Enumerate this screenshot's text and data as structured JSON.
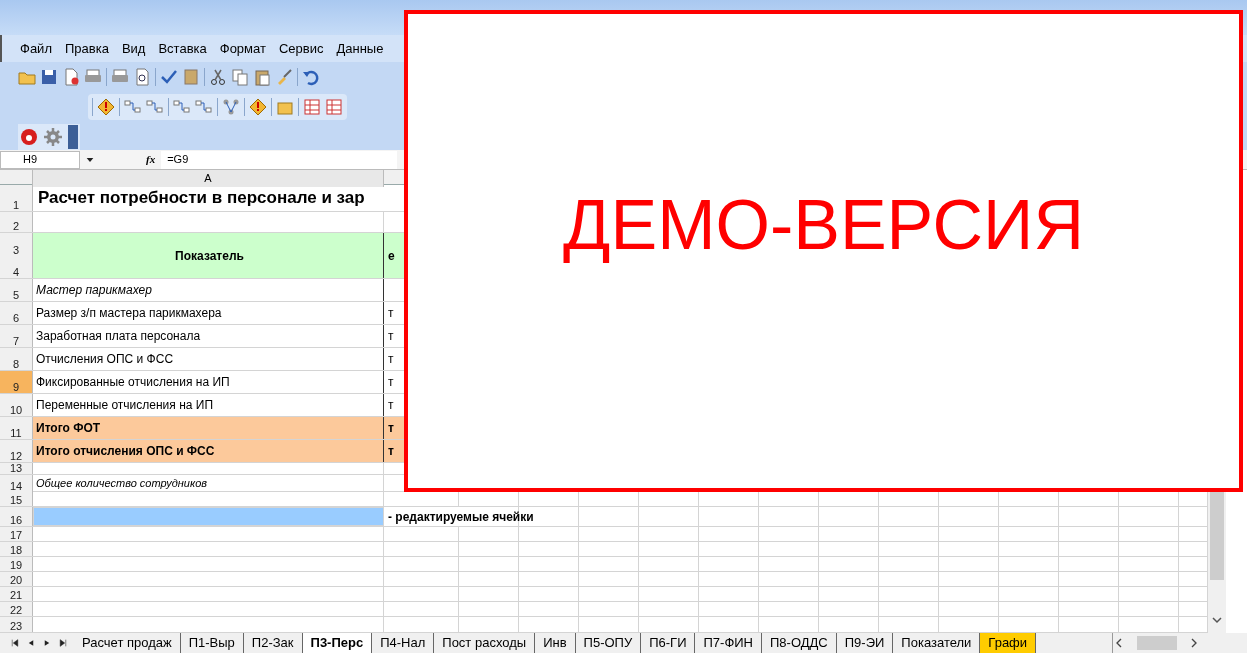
{
  "menu": [
    "Файл",
    "Правка",
    "Вид",
    "Вставка",
    "Формат",
    "Сервис",
    "Данные"
  ],
  "formula_bar": {
    "name_box": "H9",
    "fx": "fx",
    "formula": "=G9"
  },
  "columns": [
    "A"
  ],
  "rows": [
    {
      "numbers": [
        "1"
      ],
      "kind": "title",
      "selected": false,
      "cells": [
        "Расчет потребности в персонале и зар"
      ]
    },
    {
      "numbers": [
        "2"
      ],
      "kind": "blank",
      "selected": false,
      "cells": []
    },
    {
      "numbers": [
        "3",
        "4"
      ],
      "kind": "header",
      "selected": false,
      "cells": [
        "Показатель",
        "е"
      ]
    },
    {
      "numbers": [
        "5"
      ],
      "kind": "section",
      "selected": false,
      "cells": [
        "Мастер парикмахер"
      ]
    },
    {
      "numbers": [
        "6"
      ],
      "kind": "data",
      "selected": false,
      "cells": [
        "Размер з/п мастера парикмахера",
        "т"
      ]
    },
    {
      "numbers": [
        "7"
      ],
      "kind": "data",
      "selected": false,
      "cells": [
        "Заработная плата персонала",
        "т"
      ]
    },
    {
      "numbers": [
        "8"
      ],
      "kind": "data",
      "selected": false,
      "cells": [
        "Отчисления  ОПС и ФСС",
        "т"
      ]
    },
    {
      "numbers": [
        "9"
      ],
      "kind": "data",
      "selected": true,
      "cells": [
        "Фиксированные отчисления на ИП",
        "т"
      ]
    },
    {
      "numbers": [
        "10"
      ],
      "kind": "data",
      "selected": false,
      "cells": [
        "Переменные отчисления на ИП",
        "т"
      ]
    },
    {
      "numbers": [
        "11"
      ],
      "kind": "total",
      "selected": false,
      "cells": [
        "Итого ФОТ",
        "т"
      ]
    },
    {
      "numbers": [
        "12"
      ],
      "kind": "total",
      "selected": false,
      "cells": [
        "Итого отчисления  ОПС и ФСС",
        "т"
      ]
    },
    {
      "numbers": [
        "13"
      ],
      "kind": "small",
      "selected": false,
      "cells": []
    },
    {
      "numbers": [
        "14"
      ],
      "kind": "note",
      "selected": false,
      "cells": [
        "Общее количество сотрудников"
      ]
    },
    {
      "numbers": [
        "15"
      ],
      "kind": "blank",
      "selected": false,
      "cells": []
    },
    {
      "numbers": [
        "16"
      ],
      "kind": "legend",
      "selected": false,
      "cells": [
        "",
        "- редактируемые ячейки"
      ]
    },
    {
      "numbers": [
        "17"
      ],
      "kind": "blank",
      "selected": false,
      "cells": []
    },
    {
      "numbers": [
        "18"
      ],
      "kind": "blank",
      "selected": false,
      "cells": []
    },
    {
      "numbers": [
        "19"
      ],
      "kind": "blank",
      "selected": false,
      "cells": []
    },
    {
      "numbers": [
        "20"
      ],
      "kind": "blank",
      "selected": false,
      "cells": []
    },
    {
      "numbers": [
        "21"
      ],
      "kind": "blank",
      "selected": false,
      "cells": []
    },
    {
      "numbers": [
        "22"
      ],
      "kind": "blank",
      "selected": false,
      "cells": []
    },
    {
      "numbers": [
        "23"
      ],
      "kind": "blank",
      "selected": false,
      "cells": []
    }
  ],
  "sheet_tabs": [
    {
      "label": "Расчет продаж",
      "selected": false
    },
    {
      "label": "П1-Выр",
      "selected": false
    },
    {
      "label": "П2-Зак",
      "selected": false
    },
    {
      "label": "П3-Перс",
      "selected": true
    },
    {
      "label": "П4-Нал",
      "selected": false
    },
    {
      "label": "Пост расходы",
      "selected": false
    },
    {
      "label": "Инв",
      "selected": false
    },
    {
      "label": "П5-ОПУ",
      "selected": false
    },
    {
      "label": "П6-ГИ",
      "selected": false
    },
    {
      "label": "П7-ФИН",
      "selected": false
    },
    {
      "label": "П8-ОДДС",
      "selected": false
    },
    {
      "label": "П9-ЭИ",
      "selected": false
    },
    {
      "label": "Показатели",
      "selected": false
    },
    {
      "label": "Графи",
      "selected": false,
      "color": "#ffcc00"
    }
  ],
  "demo_banner": "ДЕМО-ВЕРСИЯ"
}
